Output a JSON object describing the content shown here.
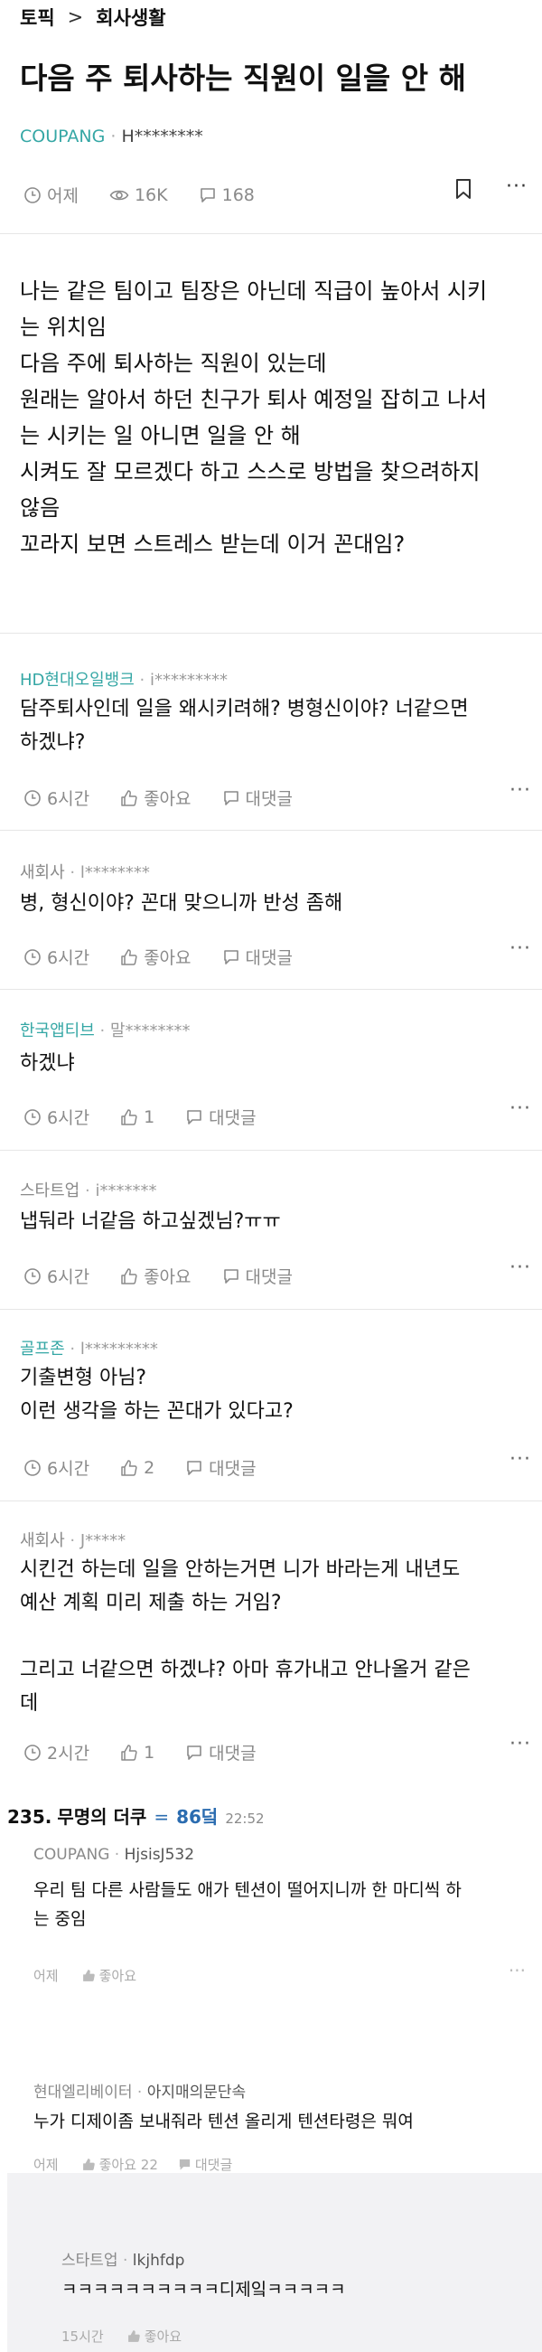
{
  "breadcrumb": {
    "first": "토픽",
    "separator": ">",
    "second": "회사생활"
  },
  "post": {
    "title": "다음 주 퇴사하는 직원이 일을 안 해",
    "company": "COUPANG",
    "user": "H********",
    "time": "어제",
    "views": "16K",
    "comments": "168",
    "body": [
      "나는 같은 팀이고 팀장은 아닌데 직급이 높아서 시키",
      "는 위치임",
      "다음 주에 퇴사하는 직원이 있는데",
      "원래는 알아서 하던 친구가 퇴사 예정일 잡히고 나서",
      "는 시키는 일 아니면 일을 안 해",
      "시켜도 잘 모르겠다 하고 스스로 방법을 찾으려하지",
      "않음",
      "꼬라지 보면 스트레스 받는데 이거 꼰대임?"
    ]
  },
  "comments": [
    {
      "company": "HD현대오일뱅크",
      "user": "i*********",
      "lines": [
        "담주퇴사인데 일을 왜시키려해? 병형신이야? 너같으면",
        "하겠냐?"
      ],
      "time": "6시간",
      "like": "좋아요",
      "reply": "대댓글"
    },
    {
      "company": "새회사",
      "user": "l********",
      "lines": [
        "병, 형신이야? 꼰대 맞으니까 반성 좀해"
      ],
      "time": "6시간",
      "like": "좋아요",
      "reply": "대댓글"
    },
    {
      "company": "한국앱티브",
      "user": "말********",
      "lines": [
        "하겠냐"
      ],
      "time": "6시간",
      "like": "1",
      "reply": "대댓글"
    },
    {
      "company": "스타트업",
      "user": "i*******",
      "lines": [
        "냅둬라 너같음 하고싶겠님?ㅠㅠ"
      ],
      "time": "6시간",
      "like": "좋아요",
      "reply": "대댓글"
    },
    {
      "company": "골프존",
      "user": "l*********",
      "lines": [
        "기출변형 아님?",
        "이런 생각을 하는 꼰대가 있다고?"
      ],
      "time": "6시간",
      "like": "2",
      "reply": "대댓글"
    },
    {
      "company": "새회사",
      "user": "J*****",
      "lines": [
        "시킨건 하는데 일을 안하는거면 니가 바라는게 내년도",
        "예산 계획 미리 제출 하는 거임?",
        "",
        "그리고 너같으면 하겠냐? 아마 휴가내고 안나올거 같은",
        "데"
      ],
      "time": "2시간",
      "like": "1",
      "reply": "대댓글"
    }
  ],
  "section": {
    "number": "235.",
    "name": "무명의 더쿠",
    "equals": "=",
    "score": "86덬",
    "time": "22:52"
  },
  "replies": [
    {
      "company": "COUPANG",
      "user": "HjsisJ532",
      "lines": [
        "우리 팀 다른 사람들도 애가 텐션이 떨어지니까 한 마디씩 하",
        "는 중임"
      ],
      "time": "어제",
      "like": "좋아요",
      "reply": ""
    },
    {
      "company": "현대엘리베이터",
      "user": "아지매의문단속",
      "lines": [
        "누가 디제이좀 보내줘라 텐션 올리게 텐션타령은 뭐여"
      ],
      "time": "어제",
      "like": "좋아요 22",
      "reply": "대댓글"
    },
    {
      "company": "스타트업",
      "user": "lkjhfdp",
      "lines": [
        "ㅋㅋㅋㅋㅋㅋㅋㅋㅋㅋ디제잌ㅋㅋㅋㅋㅋ"
      ],
      "time": "15시간",
      "like": "좋아요",
      "reply": ""
    }
  ],
  "colors": {
    "teal": "#35a7a5",
    "gray_text": "#8a8a8a",
    "section_score": "#2b6cb0",
    "reply_bg": "#f2f2f4"
  }
}
